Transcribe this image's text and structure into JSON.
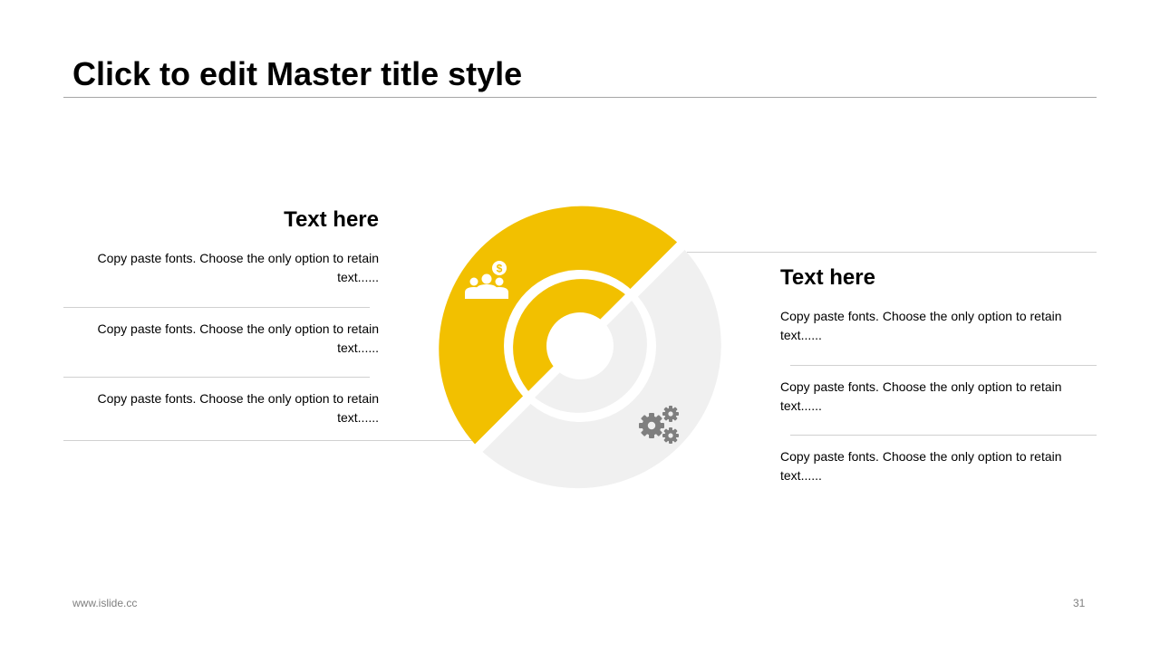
{
  "slide": {
    "title": "Click to edit Master title style"
  },
  "left_block": {
    "heading": "Text here",
    "items": [
      "Copy paste fonts. Choose the only option to retain text......",
      "Copy paste fonts. Choose the only option to retain text......",
      "Copy paste fonts. Choose the only option to retain text......"
    ]
  },
  "right_block": {
    "heading": "Text here",
    "items": [
      "Copy paste fonts. Choose the only option to retain text......",
      "Copy paste fonts. Choose the only option to retain text......",
      "Copy paste fonts. Choose the only option to retain text......"
    ]
  },
  "diagram": {
    "segments": [
      {
        "name": "people-money",
        "color": "#F2C000",
        "icon": "people-dollar-icon"
      },
      {
        "name": "gears",
        "color": "#F0F0F0",
        "icon": "gears-icon"
      }
    ],
    "icon_color_light": "#ffffff",
    "icon_color_dark": "#7f7f7f"
  },
  "footer": {
    "website": "www.islide.cc",
    "page_number": "31"
  }
}
